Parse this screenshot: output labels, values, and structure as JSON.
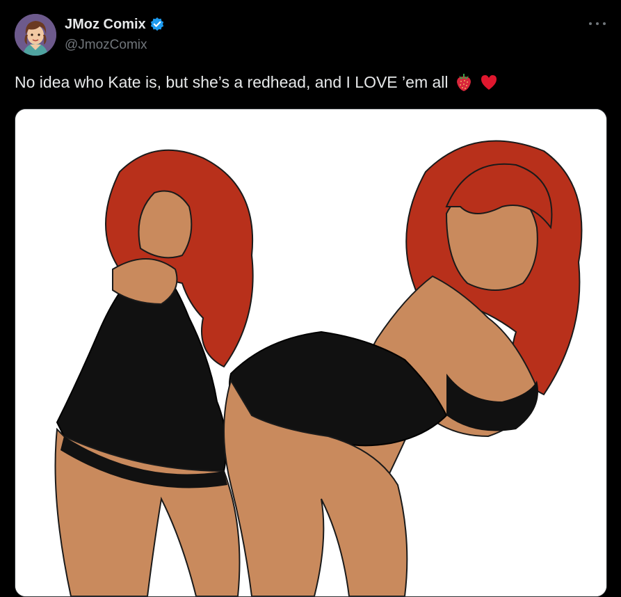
{
  "author": {
    "display_name": "JMoz Comix",
    "handle": "@JmozComix",
    "verified": true,
    "avatar_icon": "profile-avatar-illustration"
  },
  "tweet": {
    "text": "No idea who Kate is, but she’s a redhead, and I LOVE ’em all",
    "emojis": [
      "strawberry-icon",
      "red-heart-icon"
    ]
  },
  "actions": {
    "more_icon": "more-options-icon"
  },
  "media": {
    "type": "illustration",
    "icon": "cartoon-artwork-image"
  },
  "colors": {
    "background": "#000000",
    "text_primary": "#e7e9ea",
    "text_secondary": "#71767b",
    "verified_blue": "#1d9bf0",
    "media_background": "#ffffff",
    "hair": "#c0321c",
    "dress": "#111111",
    "skin": "#c98a5d"
  }
}
